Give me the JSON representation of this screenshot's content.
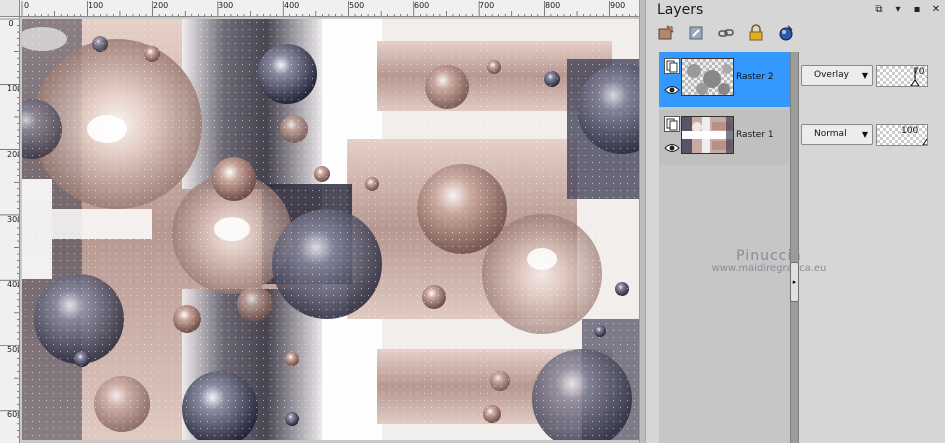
{
  "canvas": {
    "ruler_top_labels": [
      "0",
      "100",
      "200",
      "300",
      "400",
      "500",
      "600",
      "700",
      "800",
      "900"
    ],
    "ruler_left_labels": [
      "0",
      "100",
      "200",
      "300",
      "400",
      "500",
      "600"
    ]
  },
  "panel": {
    "title": "Layers",
    "controls": {
      "restore": "⧉",
      "pin": "▾",
      "autohide": "▪",
      "close": "✕"
    }
  },
  "toolbar": {
    "icons": [
      "new-layer-icon",
      "properties-icon",
      "link-icon",
      "lock-icon",
      "mask-icon"
    ]
  },
  "layers": [
    {
      "name": "Raster 2",
      "blend_mode": "Overlay",
      "opacity": "70",
      "opacity_fraction": 0.7,
      "selected": true
    },
    {
      "name": "Raster 1",
      "blend_mode": "Normal",
      "opacity": "100",
      "opacity_fraction": 1.0,
      "selected": false
    }
  ],
  "watermark": {
    "name": "Pinuccia",
    "url": "www.maidiregrafica.eu"
  },
  "colors": {
    "selection": "#3399ff",
    "panel_bg": "#d6d6d6",
    "canvas_tone_pink": "#b89a90",
    "canvas_tone_dark": "#3c3c4a"
  }
}
